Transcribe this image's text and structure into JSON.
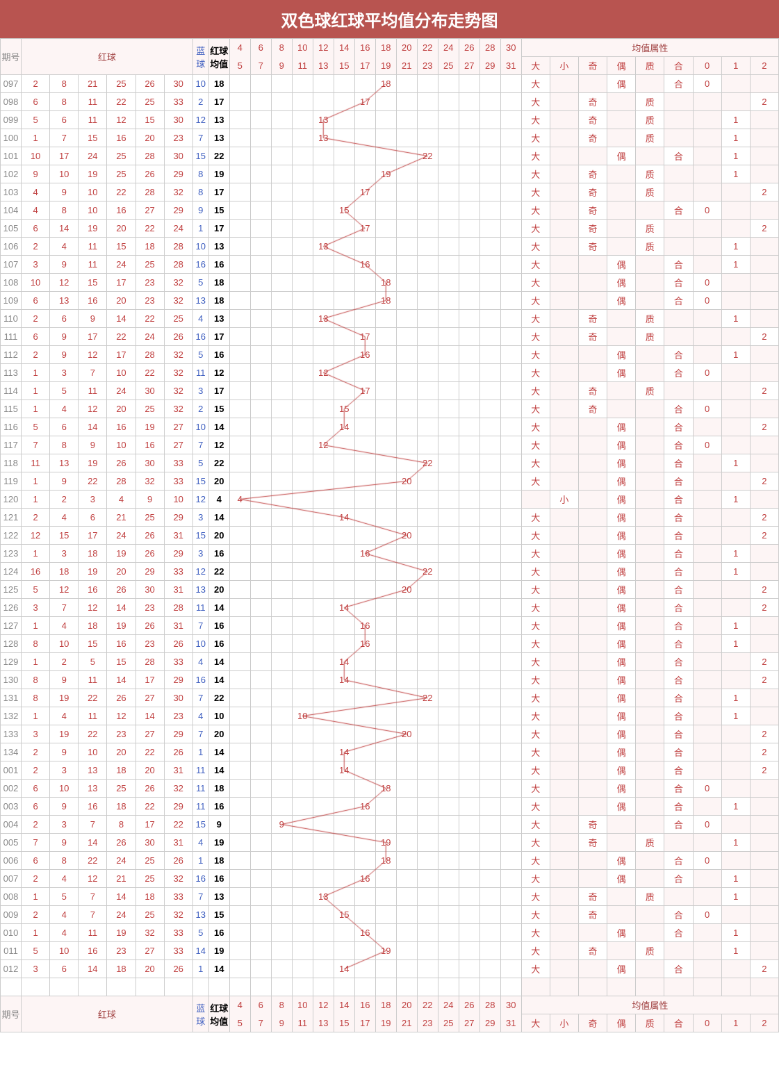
{
  "title": "双色球红球平均值分布走势图",
  "header": {
    "issue": "期号",
    "red": "红球",
    "blue": "蓝球",
    "avg": "红球均值",
    "trend_ranges": [
      "4|5",
      "6|7",
      "8|9",
      "10|11",
      "12|13",
      "14|15",
      "16|17",
      "18|19",
      "20|21",
      "22|23",
      "24|25",
      "26|27",
      "28|29",
      "30|31"
    ],
    "attr_title": "均值属性",
    "attrs": [
      "大",
      "小",
      "奇",
      "偶",
      "质",
      "合",
      "0",
      "1",
      "2"
    ]
  },
  "trend_buckets": [
    4,
    6,
    8,
    10,
    12,
    14,
    16,
    18,
    20,
    22,
    24,
    26,
    28,
    30
  ],
  "rows": [
    {
      "n": "097",
      "r": [
        2,
        8,
        21,
        25,
        26,
        30
      ],
      "b": 10,
      "a": 18,
      "t": 18,
      "p": {
        "大": "大",
        "偶": "偶",
        "合": "合",
        "0": "0"
      }
    },
    {
      "n": "098",
      "r": [
        6,
        8,
        11,
        22,
        25,
        33
      ],
      "b": 2,
      "a": 17,
      "t": 17,
      "p": {
        "大": "大",
        "奇": "奇",
        "质": "质",
        "2": "2"
      }
    },
    {
      "n": "099",
      "r": [
        5,
        6,
        11,
        12,
        15,
        30
      ],
      "b": 12,
      "a": 13,
      "t": 13,
      "p": {
        "大": "大",
        "奇": "奇",
        "质": "质",
        "1": "1"
      }
    },
    {
      "n": "100",
      "r": [
        1,
        7,
        15,
        16,
        20,
        23
      ],
      "b": 7,
      "a": 13,
      "t": 13,
      "p": {
        "大": "大",
        "奇": "奇",
        "质": "质",
        "1": "1"
      }
    },
    {
      "n": "101",
      "r": [
        10,
        17,
        24,
        25,
        28,
        30
      ],
      "b": 15,
      "a": 22,
      "t": 22,
      "p": {
        "大": "大",
        "偶": "偶",
        "合": "合",
        "1": "1"
      }
    },
    {
      "n": "102",
      "r": [
        9,
        10,
        19,
        25,
        26,
        29
      ],
      "b": 8,
      "a": 19,
      "t": 19,
      "p": {
        "大": "大",
        "奇": "奇",
        "质": "质",
        "1": "1"
      }
    },
    {
      "n": "103",
      "r": [
        4,
        9,
        10,
        22,
        28,
        32
      ],
      "b": 8,
      "a": 17,
      "t": 17,
      "p": {
        "大": "大",
        "奇": "奇",
        "质": "质",
        "2": "2"
      }
    },
    {
      "n": "104",
      "r": [
        4,
        8,
        10,
        16,
        27,
        29
      ],
      "b": 9,
      "a": 15,
      "t": 15,
      "p": {
        "大": "大",
        "奇": "奇",
        "合": "合",
        "0": "0"
      }
    },
    {
      "n": "105",
      "r": [
        6,
        14,
        19,
        20,
        22,
        24
      ],
      "b": 1,
      "a": 17,
      "t": 17,
      "p": {
        "大": "大",
        "奇": "奇",
        "质": "质",
        "2": "2"
      }
    },
    {
      "n": "106",
      "r": [
        2,
        4,
        11,
        15,
        18,
        28
      ],
      "b": 10,
      "a": 13,
      "t": 13,
      "p": {
        "大": "大",
        "奇": "奇",
        "质": "质",
        "1": "1"
      }
    },
    {
      "n": "107",
      "r": [
        3,
        9,
        11,
        24,
        25,
        28
      ],
      "b": 16,
      "a": 16,
      "t": 16,
      "p": {
        "大": "大",
        "偶": "偶",
        "合": "合",
        "1": "1"
      }
    },
    {
      "n": "108",
      "r": [
        10,
        12,
        15,
        17,
        23,
        32
      ],
      "b": 5,
      "a": 18,
      "t": 18,
      "p": {
        "大": "大",
        "偶": "偶",
        "合": "合",
        "0": "0"
      }
    },
    {
      "n": "109",
      "r": [
        6,
        13,
        16,
        20,
        23,
        32
      ],
      "b": 13,
      "a": 18,
      "t": 18,
      "p": {
        "大": "大",
        "偶": "偶",
        "合": "合",
        "0": "0"
      }
    },
    {
      "n": "110",
      "r": [
        2,
        6,
        9,
        14,
        22,
        25
      ],
      "b": 4,
      "a": 13,
      "t": 13,
      "p": {
        "大": "大",
        "奇": "奇",
        "质": "质",
        "1": "1"
      }
    },
    {
      "n": "111",
      "r": [
        6,
        9,
        17,
        22,
        24,
        26
      ],
      "b": 16,
      "a": 17,
      "t": 17,
      "p": {
        "大": "大",
        "奇": "奇",
        "质": "质",
        "2": "2"
      }
    },
    {
      "n": "112",
      "r": [
        2,
        9,
        12,
        17,
        28,
        32
      ],
      "b": 5,
      "a": 16,
      "t": 16,
      "p": {
        "大": "大",
        "偶": "偶",
        "合": "合",
        "1": "1"
      }
    },
    {
      "n": "113",
      "r": [
        1,
        3,
        7,
        10,
        22,
        32
      ],
      "b": 11,
      "a": 12,
      "t": 12,
      "p": {
        "大": "大",
        "偶": "偶",
        "合": "合",
        "0": "0"
      }
    },
    {
      "n": "114",
      "r": [
        1,
        5,
        11,
        24,
        30,
        32
      ],
      "b": 3,
      "a": 17,
      "t": 17,
      "p": {
        "大": "大",
        "奇": "奇",
        "质": "质",
        "2": "2"
      }
    },
    {
      "n": "115",
      "r": [
        1,
        4,
        12,
        20,
        25,
        32
      ],
      "b": 2,
      "a": 15,
      "t": 15,
      "p": {
        "大": "大",
        "奇": "奇",
        "合": "合",
        "0": "0"
      }
    },
    {
      "n": "116",
      "r": [
        5,
        6,
        14,
        16,
        19,
        27
      ],
      "b": 10,
      "a": 14,
      "t": 14,
      "p": {
        "大": "大",
        "偶": "偶",
        "合": "合",
        "2": "2"
      }
    },
    {
      "n": "117",
      "r": [
        7,
        8,
        9,
        10,
        16,
        27
      ],
      "b": 7,
      "a": 12,
      "t": 12,
      "p": {
        "大": "大",
        "偶": "偶",
        "合": "合",
        "0": "0"
      }
    },
    {
      "n": "118",
      "r": [
        11,
        13,
        19,
        26,
        30,
        33
      ],
      "b": 5,
      "a": 22,
      "t": 22,
      "p": {
        "大": "大",
        "偶": "偶",
        "合": "合",
        "1": "1"
      }
    },
    {
      "n": "119",
      "r": [
        1,
        9,
        22,
        28,
        32,
        33
      ],
      "b": 15,
      "a": 20,
      "t": 20,
      "p": {
        "大": "大",
        "偶": "偶",
        "合": "合",
        "2": "2"
      }
    },
    {
      "n": "120",
      "r": [
        1,
        2,
        3,
        4,
        9,
        10
      ],
      "b": 12,
      "a": 4,
      "t": 4,
      "p": {
        "小": "小",
        "偶": "偶",
        "合": "合",
        "1": "1"
      }
    },
    {
      "n": "121",
      "r": [
        2,
        4,
        6,
        21,
        25,
        29
      ],
      "b": 3,
      "a": 14,
      "t": 14,
      "p": {
        "大": "大",
        "偶": "偶",
        "合": "合",
        "2": "2"
      }
    },
    {
      "n": "122",
      "r": [
        12,
        15,
        17,
        24,
        26,
        31
      ],
      "b": 15,
      "a": 20,
      "t": 20,
      "p": {
        "大": "大",
        "偶": "偶",
        "合": "合",
        "2": "2"
      }
    },
    {
      "n": "123",
      "r": [
        1,
        3,
        18,
        19,
        26,
        29
      ],
      "b": 3,
      "a": 16,
      "t": 16,
      "p": {
        "大": "大",
        "偶": "偶",
        "合": "合",
        "1": "1"
      }
    },
    {
      "n": "124",
      "r": [
        16,
        18,
        19,
        20,
        29,
        33
      ],
      "b": 12,
      "a": 22,
      "t": 22,
      "p": {
        "大": "大",
        "偶": "偶",
        "合": "合",
        "1": "1"
      }
    },
    {
      "n": "125",
      "r": [
        5,
        12,
        16,
        26,
        30,
        31
      ],
      "b": 13,
      "a": 20,
      "t": 20,
      "p": {
        "大": "大",
        "偶": "偶",
        "合": "合",
        "2": "2"
      }
    },
    {
      "n": "126",
      "r": [
        3,
        7,
        12,
        14,
        23,
        28
      ],
      "b": 11,
      "a": 14,
      "t": 14,
      "p": {
        "大": "大",
        "偶": "偶",
        "合": "合",
        "2": "2"
      }
    },
    {
      "n": "127",
      "r": [
        1,
        4,
        18,
        19,
        26,
        31
      ],
      "b": 7,
      "a": 16,
      "t": 16,
      "p": {
        "大": "大",
        "偶": "偶",
        "合": "合",
        "1": "1"
      }
    },
    {
      "n": "128",
      "r": [
        8,
        10,
        15,
        16,
        23,
        26
      ],
      "b": 10,
      "a": 16,
      "t": 16,
      "p": {
        "大": "大",
        "偶": "偶",
        "合": "合",
        "1": "1"
      }
    },
    {
      "n": "129",
      "r": [
        1,
        2,
        5,
        15,
        28,
        33
      ],
      "b": 4,
      "a": 14,
      "t": 14,
      "p": {
        "大": "大",
        "偶": "偶",
        "合": "合",
        "2": "2"
      }
    },
    {
      "n": "130",
      "r": [
        8,
        9,
        11,
        14,
        17,
        29
      ],
      "b": 16,
      "a": 14,
      "t": 14,
      "p": {
        "大": "大",
        "偶": "偶",
        "合": "合",
        "2": "2"
      }
    },
    {
      "n": "131",
      "r": [
        8,
        19,
        22,
        26,
        27,
        30
      ],
      "b": 7,
      "a": 22,
      "t": 22,
      "p": {
        "大": "大",
        "偶": "偶",
        "合": "合",
        "1": "1"
      }
    },
    {
      "n": "132",
      "r": [
        1,
        4,
        11,
        12,
        14,
        23
      ],
      "b": 4,
      "a": 10,
      "t": 10,
      "p": {
        "大": "大",
        "偶": "偶",
        "合": "合",
        "1": "1"
      }
    },
    {
      "n": "133",
      "r": [
        3,
        19,
        22,
        23,
        27,
        29
      ],
      "b": 7,
      "a": 20,
      "t": 20,
      "p": {
        "大": "大",
        "偶": "偶",
        "合": "合",
        "2": "2"
      }
    },
    {
      "n": "134",
      "r": [
        2,
        9,
        10,
        20,
        22,
        26
      ],
      "b": 1,
      "a": 14,
      "t": 14,
      "p": {
        "大": "大",
        "偶": "偶",
        "合": "合",
        "2": "2"
      }
    },
    {
      "n": "001",
      "r": [
        2,
        3,
        13,
        18,
        20,
        31
      ],
      "b": 11,
      "a": 14,
      "t": 14,
      "p": {
        "大": "大",
        "偶": "偶",
        "合": "合",
        "2": "2"
      }
    },
    {
      "n": "002",
      "r": [
        6,
        10,
        13,
        25,
        26,
        32
      ],
      "b": 11,
      "a": 18,
      "t": 18,
      "p": {
        "大": "大",
        "偶": "偶",
        "合": "合",
        "0": "0"
      }
    },
    {
      "n": "003",
      "r": [
        6,
        9,
        16,
        18,
        22,
        29
      ],
      "b": 11,
      "a": 16,
      "t": 16,
      "p": {
        "大": "大",
        "偶": "偶",
        "合": "合",
        "1": "1"
      }
    },
    {
      "n": "004",
      "r": [
        2,
        3,
        7,
        8,
        17,
        22
      ],
      "b": 15,
      "a": 9,
      "t": 9,
      "p": {
        "大": "大",
        "奇": "奇",
        "合": "合",
        "0": "0"
      }
    },
    {
      "n": "005",
      "r": [
        7,
        9,
        14,
        26,
        30,
        31
      ],
      "b": 4,
      "a": 19,
      "t": 19,
      "p": {
        "大": "大",
        "奇": "奇",
        "质": "质",
        "1": "1"
      }
    },
    {
      "n": "006",
      "r": [
        6,
        8,
        22,
        24,
        25,
        26
      ],
      "b": 1,
      "a": 18,
      "t": 18,
      "p": {
        "大": "大",
        "偶": "偶",
        "合": "合",
        "0": "0"
      }
    },
    {
      "n": "007",
      "r": [
        2,
        4,
        12,
        21,
        25,
        32
      ],
      "b": 16,
      "a": 16,
      "t": 16,
      "p": {
        "大": "大",
        "偶": "偶",
        "合": "合",
        "1": "1"
      }
    },
    {
      "n": "008",
      "r": [
        1,
        5,
        7,
        14,
        18,
        33
      ],
      "b": 7,
      "a": 13,
      "t": 13,
      "p": {
        "大": "大",
        "奇": "奇",
        "质": "质",
        "1": "1"
      }
    },
    {
      "n": "009",
      "r": [
        2,
        4,
        7,
        24,
        25,
        32
      ],
      "b": 13,
      "a": 15,
      "t": 15,
      "p": {
        "大": "大",
        "奇": "奇",
        "合": "合",
        "0": "0"
      }
    },
    {
      "n": "010",
      "r": [
        1,
        4,
        11,
        19,
        32,
        33
      ],
      "b": 5,
      "a": 16,
      "t": 16,
      "p": {
        "大": "大",
        "偶": "偶",
        "合": "合",
        "1": "1"
      }
    },
    {
      "n": "011",
      "r": [
        5,
        10,
        16,
        23,
        27,
        33
      ],
      "b": 14,
      "a": 19,
      "t": 19,
      "p": {
        "大": "大",
        "奇": "奇",
        "质": "质",
        "1": "1"
      }
    },
    {
      "n": "012",
      "r": [
        3,
        6,
        14,
        18,
        20,
        26
      ],
      "b": 1,
      "a": 14,
      "t": 14,
      "p": {
        "大": "大",
        "偶": "偶",
        "合": "合",
        "2": "2"
      }
    }
  ]
}
